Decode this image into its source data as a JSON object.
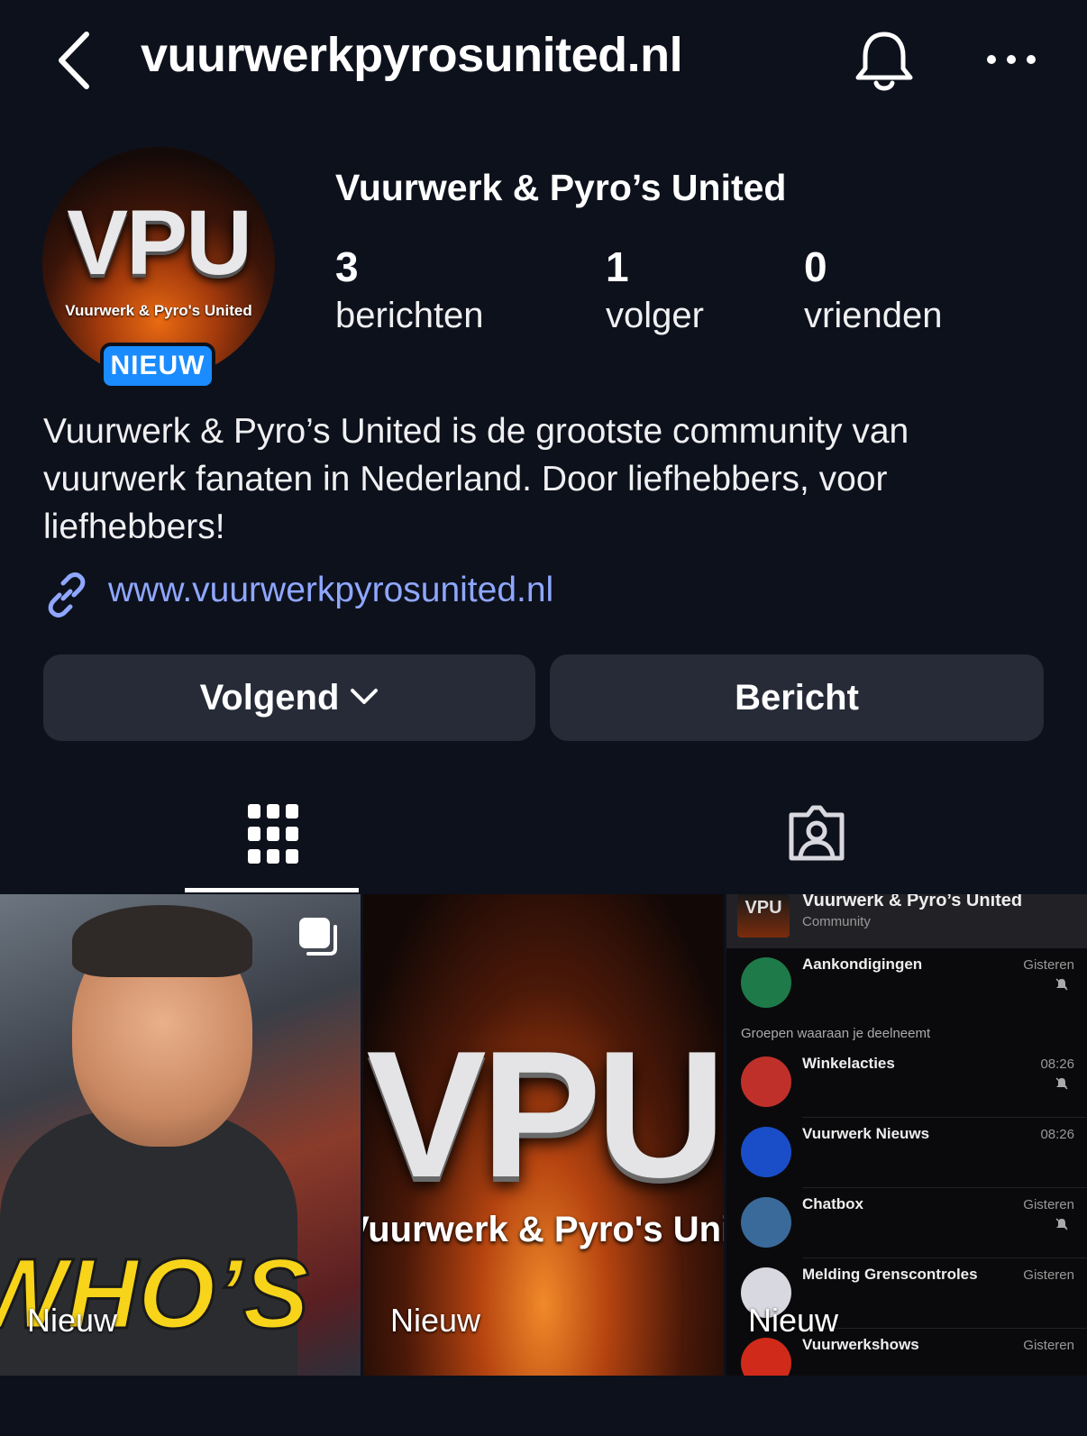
{
  "header": {
    "title": "vuurwerkpyrosunited.nl"
  },
  "profile": {
    "avatar_logo": "VPU",
    "avatar_subtitle": "Vuurwerk & Pyro's United",
    "badge": "NIEUW",
    "name": "Vuurwerk & Pyro’s United",
    "stats": [
      {
        "value": "3",
        "label": "berichten"
      },
      {
        "value": "1",
        "label": "volger"
      },
      {
        "value": "0",
        "label": "vrienden"
      }
    ],
    "bio": "Vuurwerk & Pyro’s United is de grootste community van vuurwerk fanaten in Nederland. Door liefhebbers, voor liefhebbers!",
    "link": "www.vuurwerkpyrosunited.nl"
  },
  "actions": {
    "follow_label": "Volgend",
    "message_label": "Bericht"
  },
  "tabs": [
    {
      "icon": "grid-icon",
      "active": true
    },
    {
      "icon": "tagged-person-icon",
      "active": false
    }
  ],
  "posts": [
    {
      "label": "Nieuw",
      "overlay_text": "WHO’S",
      "multi": true
    },
    {
      "label": "Nieuw",
      "overlay_text": "VPU",
      "overlay_sub": "Vuurwerk & Pyro's United"
    },
    {
      "label": "Nieuw",
      "chat": {
        "logo": "VPU",
        "title": "Vuurwerk & Pyro’s United",
        "subtitle": "Community",
        "section_label": "Groepen waaraan je deelneemt",
        "items": [
          {
            "name": "Aankondigingen",
            "time": "Gisteren",
            "muted": true,
            "color": "#1f7a4a"
          },
          {
            "name": "Winkelacties",
            "time": "08:26",
            "muted": true,
            "color": "#c0302a"
          },
          {
            "name": "Vuurwerk Nieuws",
            "time": "08:26",
            "muted": false,
            "color": "#1a4ec8"
          },
          {
            "name": "Chatbox",
            "time": "Gisteren",
            "muted": true,
            "color": "#3a6a9a"
          },
          {
            "name": "Melding Grenscontroles",
            "time": "Gisteren",
            "muted": false,
            "color": "#d8d8e0"
          },
          {
            "name": "Vuurwerkshows",
            "time": "Gisteren",
            "muted": true,
            "color": "#d02a1a"
          }
        ]
      }
    }
  ],
  "colors": {
    "background": "#0d111c",
    "button": "#262b37",
    "link": "#8fa7ff",
    "badge": "#1a8cff"
  }
}
